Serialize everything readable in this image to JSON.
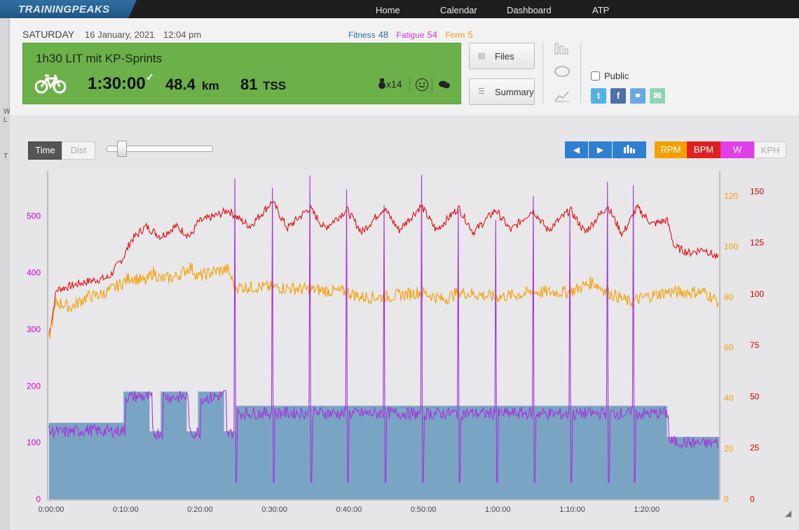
{
  "app": {
    "logo": "TRAININGPEAKS"
  },
  "nav": [
    "Home",
    "Calendar",
    "Dashboard",
    "ATP"
  ],
  "edge_letters": [
    "W",
    "L",
    "T"
  ],
  "header": {
    "day": "SATURDAY",
    "date": "16 January, 2021",
    "time": "12:04 pm",
    "fitness_label": "Fitness",
    "fitness_value": "48",
    "fatigue_label": "Fatigue",
    "fatigue_value": "54",
    "form_label": "Form",
    "form_value": "5",
    "colors": {
      "fitness": "#2f6ea3",
      "fatigue": "#d933c8",
      "form": "#f39c12",
      "completed": "#6cb04a"
    }
  },
  "workout": {
    "title": "1h30 LIT mit KP-Sprints",
    "duration": "1:30:00",
    "completed_mark": "✓",
    "distance": "48.4",
    "distance_unit": "km",
    "tss": "81",
    "tss_unit": "TSS",
    "medal_count": "x14",
    "sport_icon": "bike-icon"
  },
  "buttons": {
    "files": "Files",
    "summary": "Summary"
  },
  "sharing": {
    "public_label": "Public",
    "public_checked": false
  },
  "controls": {
    "time": "Time",
    "dist": "Dist",
    "active_axis": "Time",
    "zoom_slider": 0.15,
    "channels": [
      "RPM",
      "BPM",
      "W",
      "KPH"
    ],
    "channel_colors": {
      "RPM": "#f5a000",
      "BPM": "#e02020",
      "W": "#e040e8",
      "KPH": "#f0f0f0"
    }
  },
  "chart_data": {
    "type": "line",
    "x_ticks": [
      "0:00:00",
      "0:10:00",
      "0:20:00",
      "0:30:00",
      "0:40:00",
      "0:50:00",
      "1:00:00",
      "1:10:00",
      "1:20:00"
    ],
    "xlim_minutes": [
      0,
      90
    ],
    "axes": {
      "power": {
        "ticks": [
          0,
          100,
          200,
          300,
          400,
          500
        ],
        "range": [
          0,
          580
        ],
        "color": "#d400d4"
      },
      "cadence": {
        "ticks": [
          0,
          20,
          40,
          60,
          80,
          100,
          120
        ],
        "range": [
          0,
          130
        ],
        "color": "#f5a000"
      },
      "hr": {
        "ticks": [
          0,
          25,
          50,
          75,
          100,
          125,
          150
        ],
        "range": [
          0,
          160
        ],
        "color": "#d00000"
      }
    },
    "planned_power": [
      {
        "from": 0,
        "to": 10,
        "w": 135
      },
      {
        "from": 10,
        "to": 13.5,
        "w": 190
      },
      {
        "from": 13.5,
        "to": 15,
        "w": 120
      },
      {
        "from": 15,
        "to": 18.5,
        "w": 190
      },
      {
        "from": 18.5,
        "to": 20,
        "w": 120
      },
      {
        "from": 20,
        "to": 23.5,
        "w": 190
      },
      {
        "from": 23.5,
        "to": 25,
        "w": 120
      },
      {
        "from": 25,
        "to": 83,
        "w": 165
      },
      {
        "from": 83,
        "to": 90,
        "w": 110
      }
    ],
    "series": [
      {
        "name": "Power",
        "unit": "W",
        "color": "#a830dc",
        "points": [
          [
            0,
            120
          ],
          [
            2,
            118
          ],
          [
            5,
            122
          ],
          [
            8,
            120
          ],
          [
            10,
            121
          ],
          [
            10.2,
            180
          ],
          [
            12,
            182
          ],
          [
            13.5,
            180
          ],
          [
            13.8,
            115
          ],
          [
            15,
            118
          ],
          [
            15.3,
            182
          ],
          [
            17,
            180
          ],
          [
            18.5,
            181
          ],
          [
            18.8,
            116
          ],
          [
            20,
            118
          ],
          [
            20.3,
            178
          ],
          [
            22,
            180
          ],
          [
            23.5,
            185
          ],
          [
            23.8,
            112
          ],
          [
            25,
            120
          ],
          [
            25.2,
            152
          ],
          [
            30,
            152
          ],
          [
            35,
            153
          ],
          [
            40,
            151
          ],
          [
            45,
            152
          ],
          [
            50,
            151
          ],
          [
            55,
            152
          ],
          [
            60,
            151
          ],
          [
            65,
            152
          ],
          [
            70,
            150
          ],
          [
            75,
            152
          ],
          [
            80,
            151
          ],
          [
            82.8,
            152
          ],
          [
            83.2,
            102
          ],
          [
            86,
            100
          ],
          [
            88,
            98
          ],
          [
            90,
            100
          ]
        ],
        "sprints_minutes": [
          25,
          30,
          35,
          40,
          45,
          50,
          55,
          60,
          65,
          70,
          75,
          78.5
        ],
        "sprint_peak_w": 580
      },
      {
        "name": "Cadence",
        "unit": "RPM",
        "color": "#f5a000",
        "points": [
          [
            0,
            64
          ],
          [
            1,
            78
          ],
          [
            3,
            76
          ],
          [
            5,
            80
          ],
          [
            7,
            81
          ],
          [
            9,
            84
          ],
          [
            10,
            86
          ],
          [
            11,
            88
          ],
          [
            13,
            86
          ],
          [
            14,
            90
          ],
          [
            15,
            87
          ],
          [
            17,
            88
          ],
          [
            19,
            92
          ],
          [
            20,
            88
          ],
          [
            22,
            90
          ],
          [
            24,
            91
          ],
          [
            25,
            84
          ],
          [
            28,
            84
          ],
          [
            30,
            84
          ],
          [
            35,
            83
          ],
          [
            40,
            82
          ],
          [
            42,
            80
          ],
          [
            45,
            80
          ],
          [
            50,
            82
          ],
          [
            53,
            79
          ],
          [
            55,
            82
          ],
          [
            60,
            80
          ],
          [
            63,
            81
          ],
          [
            65,
            82
          ],
          [
            70,
            82
          ],
          [
            73,
            86
          ],
          [
            75,
            82
          ],
          [
            78,
            78
          ],
          [
            80,
            80
          ],
          [
            83,
            82
          ],
          [
            85,
            82
          ],
          [
            88,
            82
          ],
          [
            90,
            78
          ]
        ]
      },
      {
        "name": "Heart Rate",
        "unit": "BPM",
        "color": "#e01010",
        "points": [
          [
            0,
            80
          ],
          [
            1,
            102
          ],
          [
            3,
            104
          ],
          [
            5,
            106
          ],
          [
            8,
            108
          ],
          [
            10,
            118
          ],
          [
            11,
            126
          ],
          [
            13,
            133
          ],
          [
            15,
            128
          ],
          [
            17,
            133
          ],
          [
            19,
            128
          ],
          [
            20,
            135
          ],
          [
            23,
            139
          ],
          [
            24,
            141
          ],
          [
            25,
            138
          ],
          [
            27,
            133
          ],
          [
            30,
            145
          ],
          [
            32,
            132
          ],
          [
            35,
            142
          ],
          [
            37,
            132
          ],
          [
            40,
            141
          ],
          [
            42,
            130
          ],
          [
            45,
            142
          ],
          [
            47,
            131
          ],
          [
            50,
            143
          ],
          [
            52,
            131
          ],
          [
            55,
            142
          ],
          [
            57,
            130
          ],
          [
            60,
            141
          ],
          [
            62,
            131
          ],
          [
            65,
            141
          ],
          [
            67,
            131
          ],
          [
            70,
            141
          ],
          [
            72,
            130
          ],
          [
            75,
            143
          ],
          [
            77,
            129
          ],
          [
            79,
            142
          ],
          [
            81,
            134
          ],
          [
            83,
            136
          ],
          [
            84,
            123
          ],
          [
            86,
            120
          ],
          [
            88,
            122
          ],
          [
            90,
            117
          ]
        ]
      }
    ]
  }
}
